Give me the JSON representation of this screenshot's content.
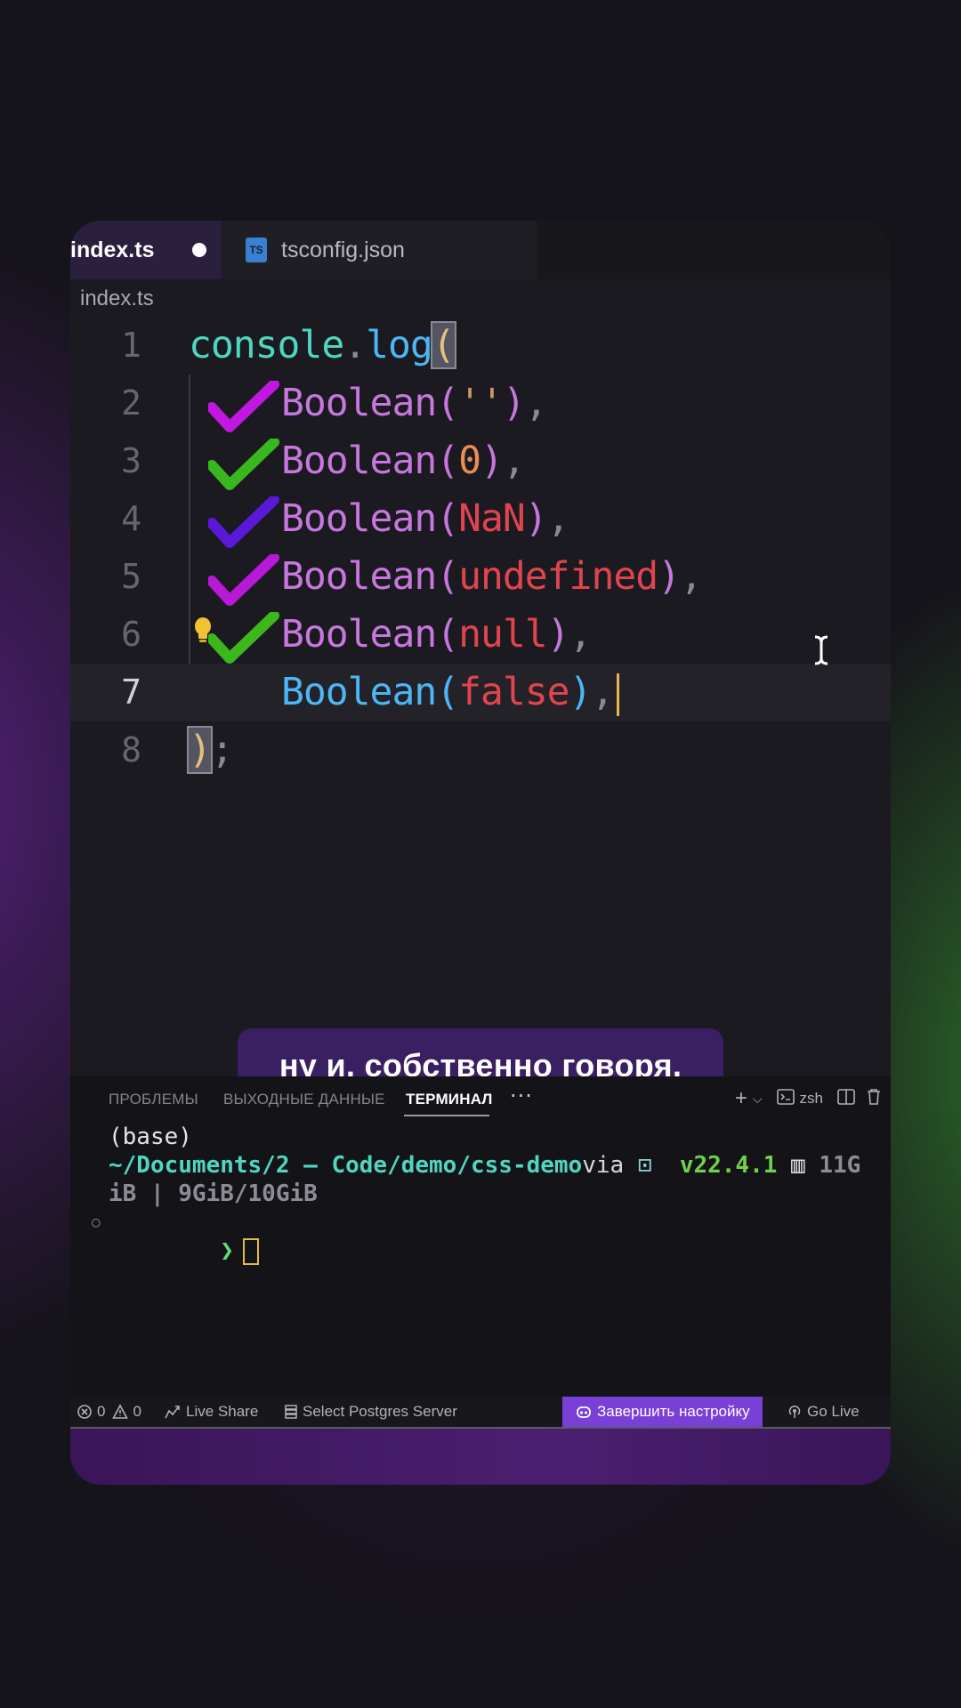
{
  "tabs": [
    {
      "label": "index.ts",
      "active": true,
      "dirty": true
    },
    {
      "label": "tsconfig.json",
      "active": false,
      "icon": "ts-config-icon",
      "icon_text": "TS"
    }
  ],
  "breadcrumb": "index.ts",
  "editor": {
    "line_numbers": [
      "1",
      "2",
      "3",
      "4",
      "5",
      "6",
      "7",
      "8"
    ],
    "current_line": 7,
    "code": {
      "console": "console",
      "dot": ".",
      "log": "log",
      "open_paren": "(",
      "boolean": "Boolean",
      "args": [
        "''",
        "0",
        "NaN",
        "undefined",
        "null",
        "false"
      ],
      "close": ")",
      "semi": ";"
    },
    "checkmarks": [
      {
        "line": 2,
        "color": "#c018e0"
      },
      {
        "line": 3,
        "color": "#38b81c"
      },
      {
        "line": 4,
        "color": "#5a18d8"
      },
      {
        "line": 5,
        "color": "#b818d8"
      },
      {
        "line": 6,
        "color": "#3ab81c"
      }
    ]
  },
  "subtitle": "ну и, собственно говоря,",
  "panel": {
    "tabs": [
      "ПРОБЛЕМЫ",
      "ВЫХОДНЫЕ ДАННЫЕ",
      "ТЕРМИНАЛ"
    ],
    "active_tab": "ТЕРМИНАЛ",
    "more": "···",
    "shell": "zsh",
    "terminal": {
      "line1": "(base)",
      "path": "~/Documents/2 – Code/demo/css-demo",
      "via": "via",
      "node_version": "v22.4.1",
      "mem_part1": "11G",
      "mem_part2": "iB | 9GiB/10GiB",
      "prompt": "❯"
    }
  },
  "statusbar": {
    "errors": "0",
    "warnings": "0",
    "live_share": "Live Share",
    "postgres": "Select Postgres Server",
    "finish_setup": "Завершить настройку",
    "go_live": "Go Live"
  }
}
